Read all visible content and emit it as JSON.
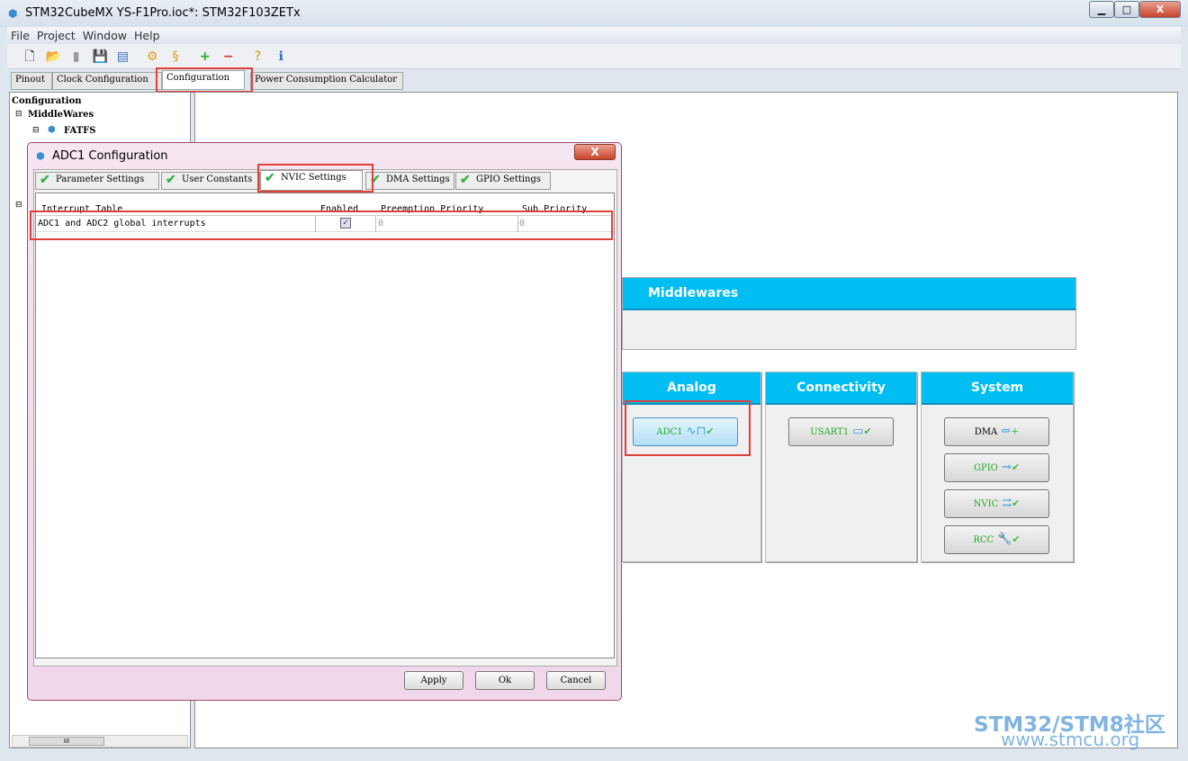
{
  "window": {
    "title": "STM32CubeMX YS-F1Pro.ioc*: STM32F103ZETx",
    "minimize": "▁",
    "maximize": "□",
    "close": "X"
  },
  "menu": [
    "File",
    "Project",
    "Window",
    "Help"
  ],
  "tabs": [
    "Pinout",
    "Clock Configuration",
    "Configuration",
    "Power Consumption Calculator"
  ],
  "tree": {
    "root": "Configuration",
    "group": "MiddleWares",
    "item": "FATFS"
  },
  "scroll_label": "III",
  "dialog": {
    "title": "ADC1 Configuration",
    "close": "X",
    "tabs": [
      "Parameter Settings",
      "User Constants",
      "NVIC Settings",
      "DMA Settings",
      "GPIO Settings"
    ],
    "selected_tab": "NVIC Settings",
    "columns": [
      "Interrupt Table",
      "Enabled",
      "Preemption Priority",
      "Sub Priority"
    ],
    "rows": [
      {
        "name": "ADC1 and ADC2 global interrupts",
        "enabled": true,
        "preemption": "0",
        "sub": "0"
      }
    ],
    "buttons": {
      "apply": "Apply",
      "ok": "Ok",
      "cancel": "Cancel"
    }
  },
  "middlewares": {
    "title": "Middlewares"
  },
  "categories": [
    {
      "title": "Analog",
      "items": [
        "ADC1"
      ]
    },
    {
      "title": "Connectivity",
      "items": [
        "USART1"
      ]
    },
    {
      "title": "System",
      "items": [
        "DMA",
        "GPIO",
        "NVIC",
        "RCC"
      ]
    }
  ],
  "watermark": {
    "line1": "STM32/STM8社区",
    "line2": "www.stmcu.org"
  },
  "colors": {
    "category_header": "#00bdf2",
    "highlight": "#e0403a",
    "check": "#3bb04a"
  }
}
